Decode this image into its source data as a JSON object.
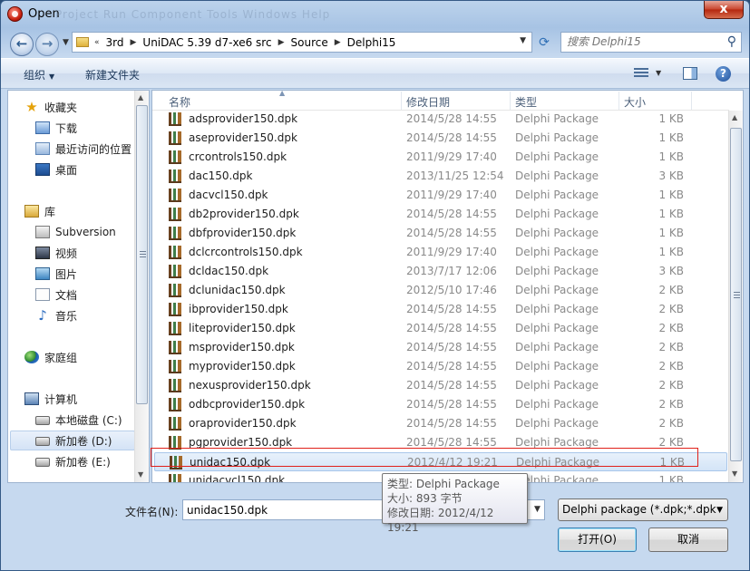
{
  "window": {
    "title": "Open",
    "ghost_menu": "Project   Run   Component   Tools   Windows   Help",
    "close_label": "x"
  },
  "address": {
    "crumbs": [
      "3rd",
      "UniDAC 5.39 d7-xe6 src",
      "Source",
      "Delphi15"
    ],
    "search_placeholder": "搜索 Delphi15"
  },
  "toolbar": {
    "organize_label": "组织",
    "new_folder_label": "新建文件夹"
  },
  "nav": {
    "items": [
      {
        "label": "收藏夹"
      },
      {
        "label": "下载"
      },
      {
        "label": "最近访问的位置"
      },
      {
        "label": "桌面"
      },
      {
        "label": "库"
      },
      {
        "label": "Subversion"
      },
      {
        "label": "视频"
      },
      {
        "label": "图片"
      },
      {
        "label": "文档"
      },
      {
        "label": "音乐"
      },
      {
        "label": "家庭组"
      },
      {
        "label": "计算机"
      },
      {
        "label": "本地磁盘 (C:)"
      },
      {
        "label": "新加卷 (D:)"
      },
      {
        "label": "新加卷 (E:)"
      }
    ],
    "selected_index": 13
  },
  "columns": {
    "name": "名称",
    "date": "修改日期",
    "type": "类型",
    "size": "大小"
  },
  "files": [
    {
      "name": "adsprovider150.dpk",
      "date": "2014/5/28 14:55",
      "type": "Delphi Package",
      "size": "1 KB"
    },
    {
      "name": "aseprovider150.dpk",
      "date": "2014/5/28 14:55",
      "type": "Delphi Package",
      "size": "1 KB"
    },
    {
      "name": "crcontrols150.dpk",
      "date": "2011/9/29 17:40",
      "type": "Delphi Package",
      "size": "1 KB"
    },
    {
      "name": "dac150.dpk",
      "date": "2013/11/25 12:54",
      "type": "Delphi Package",
      "size": "3 KB"
    },
    {
      "name": "dacvcl150.dpk",
      "date": "2011/9/29 17:40",
      "type": "Delphi Package",
      "size": "1 KB"
    },
    {
      "name": "db2provider150.dpk",
      "date": "2014/5/28 14:55",
      "type": "Delphi Package",
      "size": "1 KB"
    },
    {
      "name": "dbfprovider150.dpk",
      "date": "2014/5/28 14:55",
      "type": "Delphi Package",
      "size": "1 KB"
    },
    {
      "name": "dclcrcontrols150.dpk",
      "date": "2011/9/29 17:40",
      "type": "Delphi Package",
      "size": "1 KB"
    },
    {
      "name": "dcldac150.dpk",
      "date": "2013/7/17 12:06",
      "type": "Delphi Package",
      "size": "3 KB"
    },
    {
      "name": "dclunidac150.dpk",
      "date": "2012/5/10 17:46",
      "type": "Delphi Package",
      "size": "2 KB"
    },
    {
      "name": "ibprovider150.dpk",
      "date": "2014/5/28 14:55",
      "type": "Delphi Package",
      "size": "2 KB"
    },
    {
      "name": "liteprovider150.dpk",
      "date": "2014/5/28 14:55",
      "type": "Delphi Package",
      "size": "2 KB"
    },
    {
      "name": "msprovider150.dpk",
      "date": "2014/5/28 14:55",
      "type": "Delphi Package",
      "size": "2 KB"
    },
    {
      "name": "myprovider150.dpk",
      "date": "2014/5/28 14:55",
      "type": "Delphi Package",
      "size": "2 KB"
    },
    {
      "name": "nexusprovider150.dpk",
      "date": "2014/5/28 14:55",
      "type": "Delphi Package",
      "size": "2 KB"
    },
    {
      "name": "odbcprovider150.dpk",
      "date": "2014/5/28 14:55",
      "type": "Delphi Package",
      "size": "2 KB"
    },
    {
      "name": "oraprovider150.dpk",
      "date": "2014/5/28 14:55",
      "type": "Delphi Package",
      "size": "2 KB"
    },
    {
      "name": "pgprovider150.dpk",
      "date": "2014/5/28 14:55",
      "type": "Delphi Package",
      "size": "2 KB"
    },
    {
      "name": "unidac150.dpk",
      "date": "2012/4/12 19:21",
      "type": "Delphi Package",
      "size": "1 KB"
    },
    {
      "name": "unidacvcl150.dpk",
      "date": "2012/4/12 19:21",
      "type": "Delphi Package",
      "size": "1 KB"
    }
  ],
  "selected_file_index": 18,
  "tooltip": {
    "type_line": "类型: Delphi Package",
    "size_line": "大小: 893 字节",
    "date_line": "修改日期: 2012/4/12 19:21"
  },
  "bottom": {
    "filename_label": "文件名(N):",
    "filename_value": "unidac150.dpk",
    "filter_value": "Delphi package (*.dpk;*.dpk",
    "open_label": "打开(O)",
    "cancel_label": "取消"
  }
}
